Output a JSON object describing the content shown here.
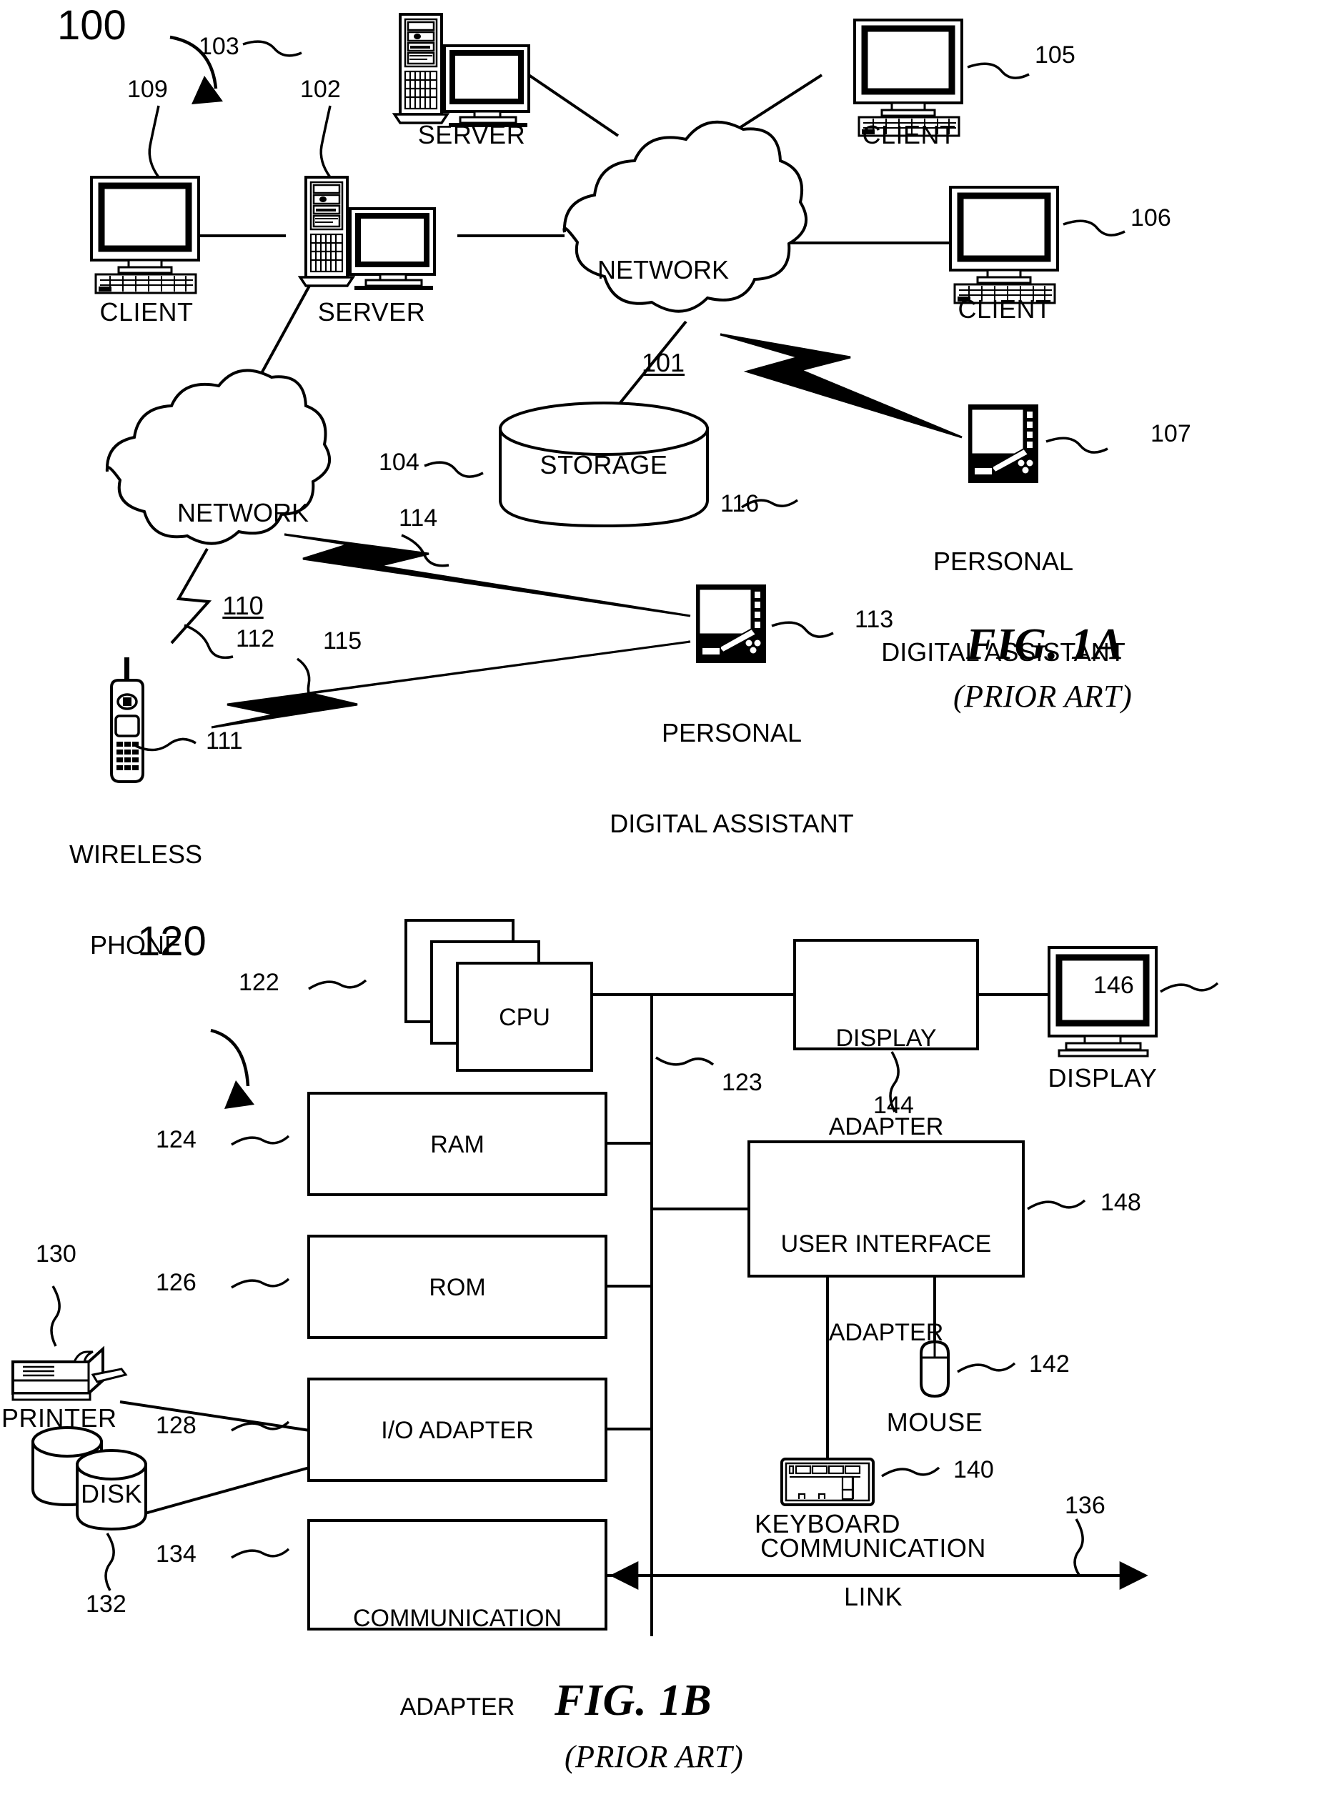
{
  "figures": [
    {
      "id": "fig1a",
      "caption": "FIG. 1A",
      "subcaption": "(PRIOR ART)",
      "system_ref": "100"
    },
    {
      "id": "fig1b",
      "caption": "FIG. 1B",
      "subcaption": "(PRIOR ART)",
      "system_ref": "120"
    }
  ],
  "fig1a": {
    "system_ref": "100",
    "caption": "FIG. 1A",
    "subcaption": "(PRIOR ART)",
    "nodes": [
      {
        "ref": "109",
        "label": "CLIENT",
        "kind": "desktop-computer"
      },
      {
        "ref": "102",
        "label": "SERVER",
        "kind": "server-tower"
      },
      {
        "ref": "103",
        "label": "SERVER",
        "kind": "server-tower"
      },
      {
        "ref": "105",
        "label": "CLIENT",
        "kind": "desktop-computer"
      },
      {
        "ref": "106",
        "label": "CLIENT",
        "kind": "desktop-computer"
      },
      {
        "ref": "104",
        "label": "STORAGE",
        "kind": "storage-cylinder"
      },
      {
        "ref": "107",
        "label": "PERSONAL DIGITAL ASSISTANT",
        "label_line1": "PERSONAL",
        "label_line2": "DIGITAL ASSISTANT",
        "kind": "pda"
      },
      {
        "ref": "113",
        "label": "PERSONAL DIGITAL ASSISTANT",
        "label_line1": "PERSONAL",
        "label_line2": "DIGITAL ASSISTANT",
        "kind": "pda"
      },
      {
        "ref": "111",
        "label": "WIRELESS PHONE",
        "label_line1": "WIRELESS",
        "label_line2": "PHONE",
        "kind": "wireless-phone"
      }
    ],
    "clouds": [
      {
        "ref": "101",
        "name": "NETWORK"
      },
      {
        "ref": "110",
        "name": "NETWORK"
      }
    ],
    "wireless_links": [
      {
        "ref": "112"
      },
      {
        "ref": "114"
      },
      {
        "ref": "115"
      },
      {
        "ref": "116"
      }
    ]
  },
  "fig1b": {
    "system_ref": "120",
    "caption": "FIG. 1B",
    "subcaption": "(PRIOR ART)",
    "blocks": [
      {
        "ref": "122",
        "label": "CPU",
        "label_line1": "CPU",
        "label_line2": ""
      },
      {
        "ref": "124",
        "label": "RAM",
        "label_line1": "RAM",
        "label_line2": ""
      },
      {
        "ref": "126",
        "label": "ROM",
        "label_line1": "ROM",
        "label_line2": ""
      },
      {
        "ref": "128",
        "label": "I/O ADAPTER",
        "label_line1": "I/O ADAPTER",
        "label_line2": ""
      },
      {
        "ref": "134",
        "label": "COMMUNICATION ADAPTER",
        "label_line1": "COMMUNICATION",
        "label_line2": "ADAPTER"
      },
      {
        "ref": "144",
        "label": "DISPLAY ADAPTER",
        "label_line1": "DISPLAY",
        "label_line2": "ADAPTER"
      },
      {
        "ref": "148",
        "label": "USER INTERFACE ADAPTER",
        "label_line1": "USER INTERFACE",
        "label_line2": "ADAPTER"
      }
    ],
    "peripherals": [
      {
        "ref": "130",
        "label": "PRINTER",
        "kind": "printer"
      },
      {
        "ref": "132",
        "label": "DISK",
        "kind": "disk"
      },
      {
        "ref": "140",
        "label": "KEYBOARD",
        "kind": "keyboard"
      },
      {
        "ref": "142",
        "label": "MOUSE",
        "kind": "mouse"
      },
      {
        "ref": "146",
        "label": "DISPLAY",
        "kind": "monitor"
      }
    ],
    "bus": {
      "ref": "123"
    },
    "comm_link": {
      "ref": "136",
      "label_line1": "COMMUNICATION",
      "label_line2": "LINK"
    }
  },
  "colors": {
    "ink": "#000000",
    "paper": "#ffffff"
  }
}
